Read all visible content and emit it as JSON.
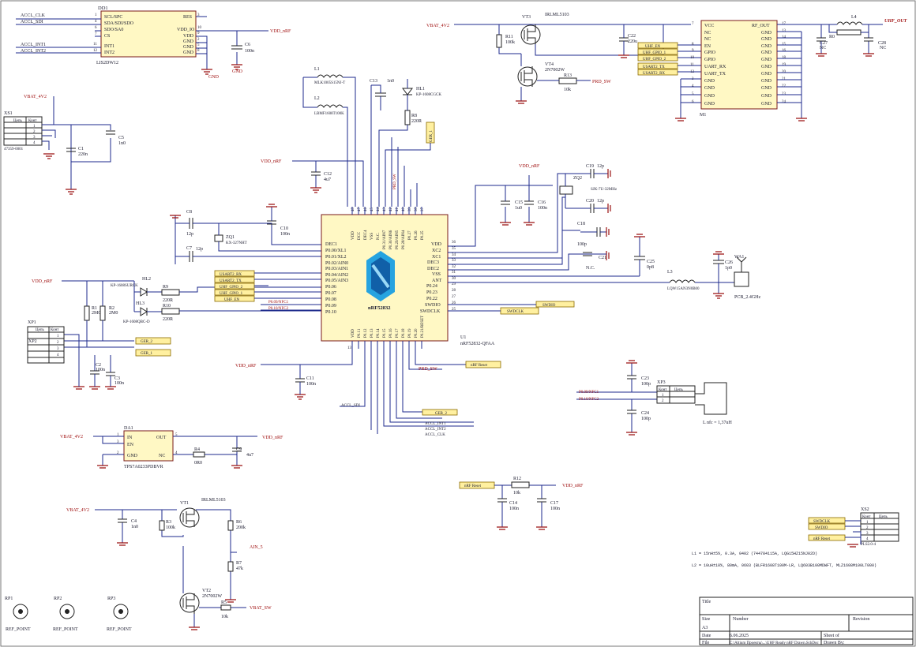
{
  "power": {
    "vdd_nrf": "VDD_nRF",
    "vbat": "VBAT_4V2",
    "gnd": "GND"
  },
  "dd1": {
    "ref": "DD1",
    "part": "LIS2DW12",
    "pins_left": [
      "SCL/SPC",
      "SDA/SDI/SDO",
      "SDO/SA0",
      "CS",
      "INT1",
      "INT2"
    ],
    "pins_right": [
      "RES",
      "VDD_IO",
      "VDD",
      "GND",
      "GND",
      "GND"
    ],
    "pin_nums_left": [
      "1",
      "4",
      "6",
      "7",
      "11",
      "12"
    ],
    "pin_nums_right": [
      "3",
      "10",
      "9",
      "2",
      "5",
      "8"
    ],
    "nets": [
      "ACCL_CLK",
      "ACCL_SDI",
      "ACCL_INT1",
      "ACCL_INT2"
    ]
  },
  "c6": {
    "ref": "C6",
    "val": "100n"
  },
  "l1": {
    "ref": "L1",
    "part": "MLK1005S15NJ-T"
  },
  "l2": {
    "ref": "L2",
    "part": "LBMF1608T100K"
  },
  "c13": {
    "ref": "C13",
    "val": "1n0"
  },
  "hl1": {
    "ref": "HL1",
    "part": "KP-1608CGCK"
  },
  "r8": {
    "ref": "R8",
    "val": "220R"
  },
  "xs1": {
    "ref": "XS1",
    "part": "47359-0001",
    "hdr": [
      "Цепь",
      "Конт"
    ],
    "pins": [
      "1",
      "2",
      "3",
      "4",
      "5"
    ]
  },
  "c1": {
    "ref": "C1",
    "val": "220n"
  },
  "c5": {
    "ref": "C5",
    "val": "1n0"
  },
  "c12": {
    "ref": "C12",
    "val": "4u7"
  },
  "c8": {
    "ref": "C8",
    "val": "12p"
  },
  "c7": {
    "ref": "C7",
    "val": "12p"
  },
  "zq1": {
    "ref": "ZQ1",
    "part": "KX-327NHT"
  },
  "c10": {
    "ref": "C10",
    "val": "100n"
  },
  "hl2": {
    "ref": "HL2",
    "part": "KP-1608SURCK"
  },
  "hl3": {
    "ref": "HL3",
    "part": "KP-1608QBC-D"
  },
  "r9": {
    "ref": "R9",
    "val": "220R"
  },
  "r10": {
    "ref": "R10",
    "val": "220R"
  },
  "r1": {
    "ref": "R1",
    "val": "2M0"
  },
  "r2": {
    "ref": "R2",
    "val": "2M0"
  },
  "xp1": {
    "ref": "XP1",
    "hdr": [
      "Цепь",
      "Конт"
    ],
    "pins": [
      "1",
      "2",
      "3",
      "4"
    ]
  },
  "xp2": {
    "ref": "XP2"
  },
  "c2": {
    "ref": "C2",
    "val": "100n"
  },
  "c3": {
    "ref": "C3",
    "val": "100n"
  },
  "u1": {
    "ref": "U1",
    "part": "nRF52832-QFAA",
    "name": "nRF52832",
    "left_pins": [
      "DEC1",
      "P0.00/XL1",
      "P0.01/XL2",
      "P0.02/AIN0",
      "P0.03/AIN1",
      "P0.04/AIN2",
      "P0.05/AIN3",
      "P0.06",
      "P0.07",
      "P0.08",
      "P0.09",
      "P0.10"
    ],
    "right_pins": [
      "VDD",
      "XC2",
      "XC1",
      "DEC3",
      "DEC2",
      "VSS",
      "ANT",
      "P0.24",
      "P0.23",
      "P0.22",
      "SWDIO",
      "SWDCLK"
    ],
    "right_nums": [
      "36",
      "35",
      "34",
      "33",
      "32",
      "31",
      "30",
      "29",
      "28",
      "27",
      "26",
      "25"
    ],
    "top_pins": [
      "VDD",
      "DCC",
      "DEC4",
      "VSS",
      "N.C.",
      "P0.31/AIN7",
      "P0.30/AIN6",
      "P0.29/AIN5",
      "P0.28/AIN4",
      "P0.27",
      "P0.26",
      "P0.25"
    ],
    "top_nums": [
      "48",
      "47",
      "46",
      "45",
      "44",
      "43",
      "42",
      "41",
      "40",
      "39",
      "38",
      "37"
    ],
    "bottom_pins": [
      "VDD",
      "P0.11",
      "P0.12",
      "P0.13",
      "P0.14",
      "P0.15",
      "P0.16",
      "P0.17",
      "P0.18",
      "P0.19",
      "P0.20",
      "P0.21/RESET"
    ],
    "bottom_nums": [
      "13",
      "14",
      "15",
      "16",
      "17",
      "18",
      "19",
      "20",
      "21",
      "22",
      "23",
      "24"
    ]
  },
  "vt3": {
    "ref": "VT3",
    "part": "IRLML5103"
  },
  "r11": {
    "ref": "R11",
    "val": "100k"
  },
  "vt4": {
    "ref": "VT4",
    "part": "2N7002W"
  },
  "r13": {
    "ref": "R13",
    "val": "10k"
  },
  "c22": {
    "ref": "C22",
    "val": "220u"
  },
  "m1": {
    "ref": "M1",
    "left_pins": [
      "VCC",
      "NC",
      "NC",
      "EN",
      "GPIO",
      "GPIO",
      "UART_RX",
      "UART_TX",
      "GND",
      "GND",
      "GND",
      "GND"
    ],
    "left_nums": [
      "7",
      "",
      "",
      "8",
      "9",
      "10",
      "11",
      "12",
      "3",
      "4",
      "5",
      "6"
    ],
    "right_pins": [
      "RF_OUT",
      "GND",
      "GND",
      "GND",
      "GND",
      "GND",
      "GND",
      "GND",
      "GND",
      "GND",
      "GND",
      "GND"
    ],
    "right_nums": [
      "17",
      "13",
      "14",
      "15",
      "16",
      "18",
      "19",
      "20",
      "21",
      "22",
      "23",
      "24"
    ]
  },
  "l4": {
    "ref": "L4"
  },
  "r0": {
    "ref": "R0"
  },
  "c27": {
    "ref": "C27",
    "val": "NC"
  },
  "c28": {
    "ref": "C28",
    "val": "NC"
  },
  "uhf_out": "UHF_OUT",
  "zq2": {
    "ref": "ZQ2",
    "part": "SJK-7U-32MHz"
  },
  "c19": {
    "ref": "C19",
    "val": "12p"
  },
  "c20": {
    "ref": "C20",
    "val": "12p"
  },
  "c15": {
    "ref": "C15",
    "val": "1u0"
  },
  "c16": {
    "ref": "C16",
    "val": "100n"
  },
  "c18": {
    "ref": "C18",
    "val": "100p"
  },
  "c21": {
    "ref": "C21",
    "val": "N.C."
  },
  "c25": {
    "ref": "C25",
    "val": "0p8"
  },
  "c26": {
    "ref": "C26",
    "val": "1p0"
  },
  "l3": {
    "ref": "L3",
    "part": "LQW15AN3N0B00"
  },
  "wa1": {
    "ref": "WA1",
    "part": "PCB_2.4GHz"
  },
  "c11": {
    "ref": "C11",
    "val": "100n"
  },
  "c23": {
    "ref": "C23",
    "val": "100p"
  },
  "c24": {
    "ref": "C24",
    "val": "100p"
  },
  "xp3": {
    "ref": "XP3",
    "hdr": [
      "Конт",
      "Цепь"
    ],
    "pins": [
      "1",
      "2"
    ]
  },
  "lnfc": "L nfc = 1,37uH",
  "da1": {
    "ref": "DA1",
    "part": "TPS7A0233PDBVR",
    "pins": [
      "IN",
      "EN",
      "GND",
      "OUT",
      "NC"
    ],
    "nums": [
      "1",
      "3",
      "2",
      "5",
      "4"
    ]
  },
  "r4": {
    "ref": "R4",
    "val": "0R0"
  },
  "c9": {
    "ref": "C9",
    "val": "4u7"
  },
  "r12": {
    "ref": "R12",
    "val": "10k"
  },
  "c14": {
    "ref": "C14",
    "val": "100n"
  },
  "c17": {
    "ref": "C17",
    "val": "100n"
  },
  "c4": {
    "ref": "C4",
    "val": "1n0"
  },
  "vt1": {
    "ref": "VT1",
    "part": "IRLML5103"
  },
  "r3": {
    "ref": "R3",
    "val": "100k"
  },
  "r6": {
    "ref": "R6",
    "val": "200k"
  },
  "r7": {
    "ref": "R7",
    "val": "47k"
  },
  "vt2": {
    "ref": "VT2",
    "part": "2N7002W"
  },
  "r5": {
    "ref": "R5",
    "val": "10k"
  },
  "ain5": "AIN_5",
  "vbat_sw": "VBAT_SW",
  "xs2": {
    "ref": "XS2",
    "part": "PLS2.0-4",
    "hdr": [
      "Конт",
      "Цепь"
    ],
    "pins": [
      "1",
      "2",
      "3",
      "4"
    ]
  },
  "rp": [
    {
      "ref": "RP1",
      "label": "REF_POINT"
    },
    {
      "ref": "RP2",
      "label": "REF_POINT"
    },
    {
      "ref": "RP3",
      "label": "REF_POINT"
    }
  ],
  "netlabels": {
    "uhf_en": "UHF_EN",
    "uhf_gpio1": "UHF_GPIO_1",
    "uhf_gpio2": "UHF_GPIO_2",
    "usart2_tx": "USART2_TX",
    "usart2_rx": "USART2_RX",
    "ger1": "GER_1",
    "ger2": "GER_2",
    "swdio": "SWDIO",
    "swdclk": "SWDCLK",
    "nrf_reset": "nRF Reset",
    "prd_sw": "PRD_SW",
    "nfc1": "P0.09/NFC1",
    "nfc2": "P0.10/NFC2",
    "accl_sdi": "ACCL_SDI",
    "accl_int1": "ACCL_INT1",
    "accl_int2": "ACCL_INT2",
    "accl_clk": "ACCL_CLK"
  },
  "notes": [
    "L1 = 15nH±5%, 0.3A, 0402 (744784115A, LQG15HZ15NJ02D)",
    "L2 = 10uH±10%, 80mA, 0603 (BLFR1608T100M-LR, LQ603B100MDWFT, MLZ1608M100LT000)"
  ],
  "title_block": {
    "title_lbl": "Title",
    "size_lbl": "Size",
    "size_val": "A3",
    "number_lbl": "Number",
    "revision_lbl": "Revision",
    "date_lbl": "Date",
    "date_val": "6.06.2025",
    "file_lbl": "File",
    "file_val": "C:\\Altium Проекты\\...\\UHF Ready nRF Drawn.SchDoc",
    "sheet_lbl": "Sheet  of",
    "drawn_lbl": "Drawn By:"
  }
}
